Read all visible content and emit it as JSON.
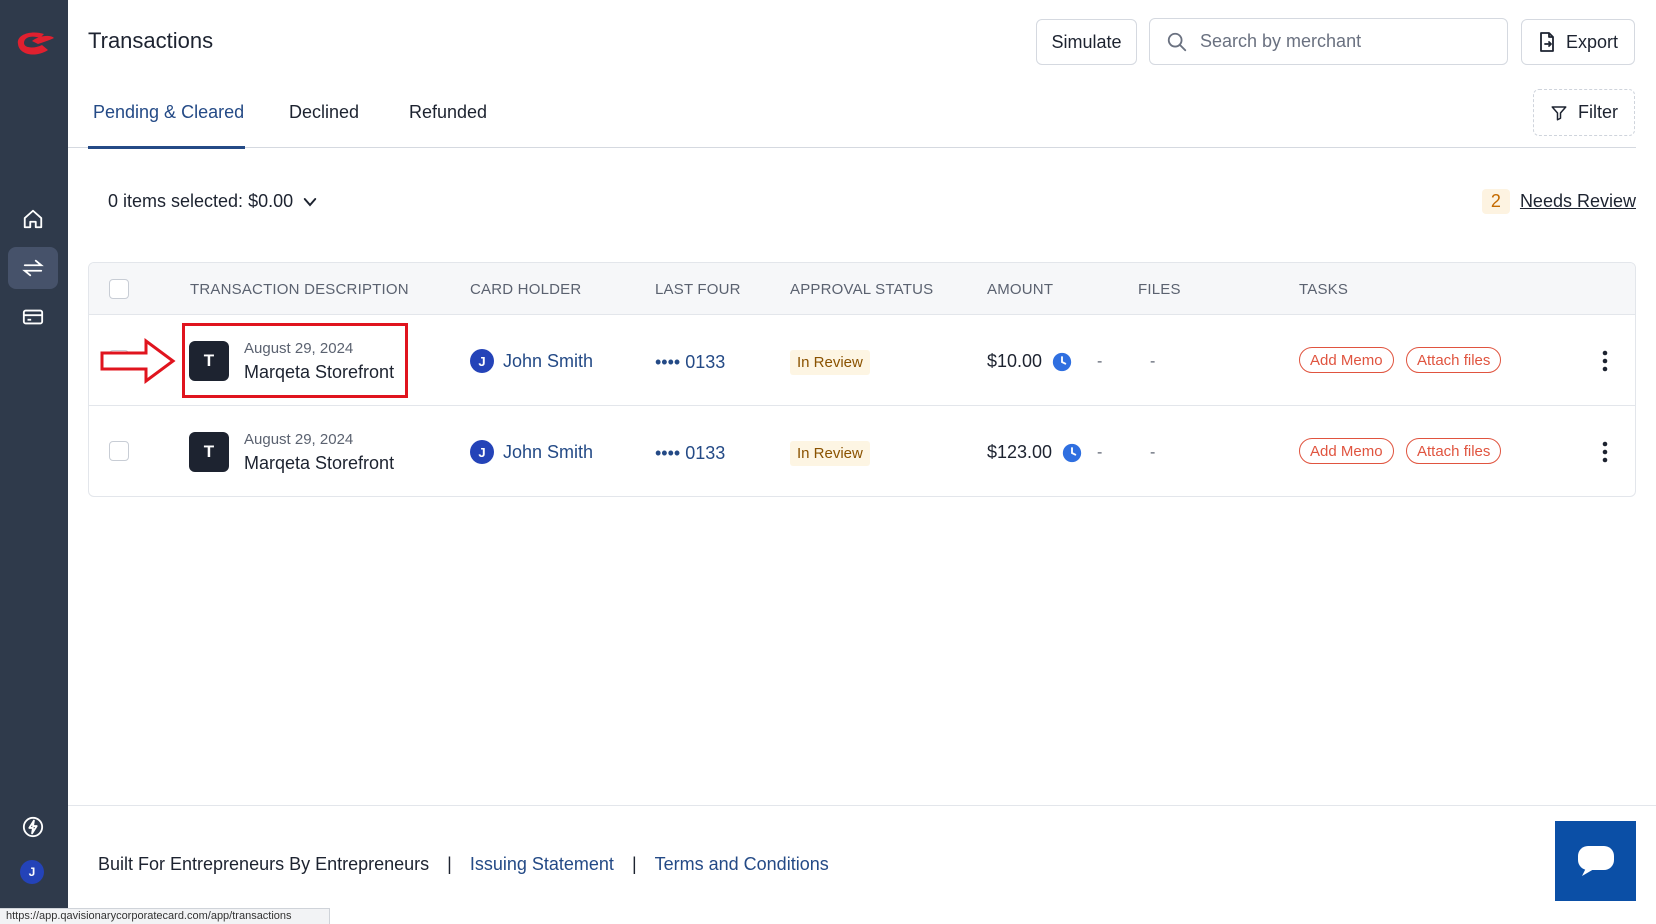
{
  "header": {
    "title": "Transactions",
    "simulate_label": "Simulate",
    "search_placeholder": "Search by merchant",
    "export_label": "Export"
  },
  "tabs": [
    {
      "label": "Pending & Cleared",
      "active": true
    },
    {
      "label": "Declined",
      "active": false
    },
    {
      "label": "Refunded",
      "active": false
    }
  ],
  "filter_label": "Filter",
  "selection": {
    "summary": "0 items selected: $0.00"
  },
  "needs_review": {
    "count": "2",
    "label": "Needs Review"
  },
  "table": {
    "columns": [
      "TRANSACTION DESCRIPTION",
      "CARD HOLDER",
      "LAST FOUR",
      "APPROVAL STATUS",
      "AMOUNT",
      "FILES",
      "TASKS"
    ],
    "rows": [
      {
        "avatar_letter": "T",
        "date": "August 29, 2024",
        "merchant": "Marqeta Storefront",
        "holder_initial": "J",
        "holder_name": "John Smith",
        "last_four": "•••• 0133",
        "status": "In Review",
        "amount": "$10.00",
        "files_1": "-",
        "files_2": "-",
        "task_memo": "Add Memo",
        "task_files": "Attach files"
      },
      {
        "avatar_letter": "T",
        "date": "August 29, 2024",
        "merchant": "Marqeta Storefront",
        "holder_initial": "J",
        "holder_name": "John Smith",
        "last_four": "•••• 0133",
        "status": "In Review",
        "amount": "$123.00",
        "files_1": "-",
        "files_2": "-",
        "task_memo": "Add Memo",
        "task_files": "Attach files"
      }
    ]
  },
  "footer": {
    "tagline": "Built For Entrepreneurs By Entrepreneurs",
    "separator": "|",
    "issuing_statement": "Issuing Statement",
    "terms": "Terms and Conditions"
  },
  "sidebar": {
    "avatar_initial": "J"
  },
  "status_bar_url": "https://app.qavisionarycorporatecard.com/app/transactions",
  "colors": {
    "sidebar_bg": "#2f3a4b",
    "accent": "#244a86",
    "task_pill": "#e0543f",
    "highlight": "#e0141e",
    "chat_button": "#0b4fa6"
  },
  "icons": {
    "logo": "brand-logo-icon",
    "home": "home-icon",
    "transactions": "transfer-arrows-icon",
    "cards": "card-icon",
    "bolt": "lightning-icon",
    "search": "search-icon",
    "export": "file-export-icon",
    "filter": "filter-icon",
    "chevron": "chevron-down-icon",
    "clock": "clock-icon",
    "kebab": "kebab-menu-icon",
    "chat": "chat-icon",
    "arrow": "annotation-arrow-icon"
  }
}
